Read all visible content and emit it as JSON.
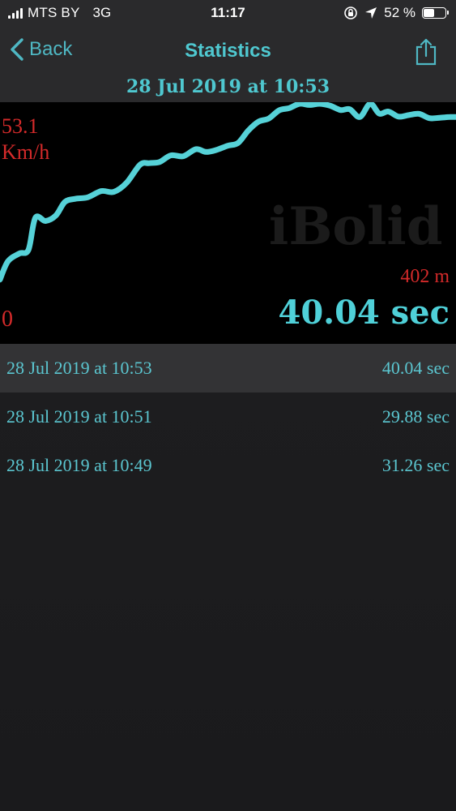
{
  "status_bar": {
    "carrier": "MTS BY",
    "network": "3G",
    "time": "11:17",
    "battery": "52 %",
    "battery_level": 0.52
  },
  "nav": {
    "back_label": "Back",
    "title": "Statistics"
  },
  "session_title": "28 Jul 2019 at 10:53",
  "chart_data": {
    "type": "line",
    "y_max_label": "53.1",
    "y_unit": "Km/h",
    "y_min_label": "0",
    "distance_label": "402 m",
    "time_label": "40.04 sec",
    "watermark": "iBolid",
    "ylim": [
      0,
      53.1
    ],
    "xlim": [
      0,
      40.04
    ],
    "line_color": "#56d2d8",
    "x": [
      0,
      0.7,
      1.7,
      2.5,
      3.1,
      4.0,
      4.9,
      5.7,
      6.6,
      7.7,
      8.9,
      10.0,
      11.1,
      12.3,
      13.1,
      14.0,
      15.0,
      16.1,
      17.2,
      18.1,
      19.0,
      20.0,
      20.9,
      21.8,
      22.7,
      23.6,
      24.5,
      25.4,
      26.3,
      27.2,
      28.1,
      29.0,
      29.9,
      30.7,
      31.6,
      32.5,
      33.3,
      34.1,
      35.0,
      35.9,
      36.8,
      37.7,
      38.6,
      39.5,
      40.04
    ],
    "y": [
      7.8,
      12.5,
      14.5,
      15.5,
      23.7,
      22.9,
      24.3,
      27.8,
      28.6,
      29.0,
      30.6,
      30.4,
      32.7,
      37.4,
      37.8,
      38.1,
      39.8,
      39.6,
      41.4,
      40.7,
      41.2,
      42.3,
      43.0,
      46.2,
      48.5,
      49.3,
      51.4,
      52.0,
      53.1,
      52.8,
      53.1,
      52.6,
      51.5,
      51.7,
      49.7,
      53.1,
      50.6,
      51.1,
      49.8,
      50.2,
      50.5,
      49.4,
      49.5,
      49.7,
      49.7
    ]
  },
  "sessions": [
    {
      "date": "28 Jul 2019 at 10:53",
      "time": "40.04 sec",
      "selected": true
    },
    {
      "date": "28 Jul 2019 at 10:51",
      "time": "29.88 sec",
      "selected": false
    },
    {
      "date": "28 Jul 2019 at 10:49",
      "time": "31.26 sec",
      "selected": false
    }
  ]
}
